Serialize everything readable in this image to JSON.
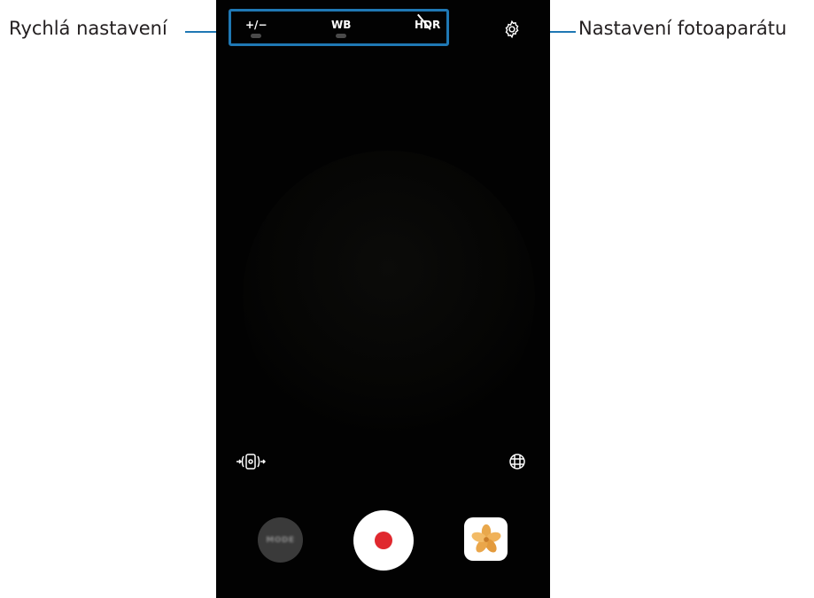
{
  "callouts": {
    "quick_settings": "Rychlá nastavení",
    "camera_settings": "Nastavení fotoaparátu"
  },
  "quick_settings": {
    "ev_label": "+/−",
    "wb_label": "WB",
    "hdr_label": "HDR"
  },
  "mode_button": {
    "label": "MODE"
  },
  "colors": {
    "callout_line": "#1f78b4",
    "record_dot": "#e0282e",
    "viewfinder": "#020202"
  },
  "icons": [
    "settings-icon",
    "switch-camera-icon",
    "grid-icon",
    "record-icon",
    "gallery-thumbnail"
  ]
}
